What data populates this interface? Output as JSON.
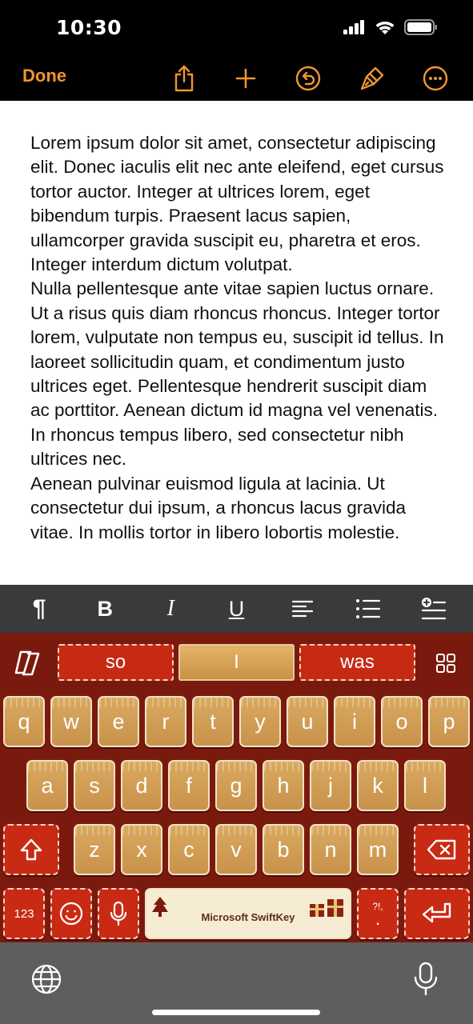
{
  "status": {
    "time": "10:30"
  },
  "nav": {
    "done_label": "Done",
    "icons": [
      "share-icon",
      "plus-icon",
      "undo-icon",
      "paintbrush-icon",
      "more-icon"
    ],
    "accent": "#f0962e"
  },
  "document": {
    "paragraphs": [
      "Lorem ipsum dolor sit amet, consectetur adipiscing elit. Donec iaculis elit nec ante eleifend, eget cursus tortor auctor. Integer at ultrices lorem, eget bibendum turpis. Praesent lacus sapien, ullamcorper gravida suscipit eu, pharetra et eros. Integer interdum dictum volutpat.",
      "Nulla pellentesque ante vitae sapien luctus ornare. Ut a risus quis diam rhoncus rhoncus. Integer tortor lorem, vulputate non tempus eu, suscipit id tellus. In laoreet sollicitudin quam, et condimentum justo ultrices eget. Pellentesque hendrerit suscipit diam ac porttitor. Aenean dictum id magna vel venenatis. In rhoncus tempus libero, sed consectetur nibh ultrices nec.",
      "Aenean pulvinar euismod ligula at lacinia. Ut consectetur dui ipsum, a rhoncus lacus gravida vitae. In mollis tortor in libero lobortis molestie."
    ]
  },
  "format_toolbar": {
    "paragraph": "¶",
    "bold": "B",
    "italic": "I",
    "underline": "U"
  },
  "keyboard": {
    "suggestions": [
      "so",
      "I",
      "was"
    ],
    "row1": [
      "q",
      "w",
      "e",
      "r",
      "t",
      "y",
      "u",
      "i",
      "o",
      "p"
    ],
    "row2": [
      "a",
      "s",
      "d",
      "f",
      "g",
      "h",
      "j",
      "k",
      "l"
    ],
    "row3": [
      "z",
      "x",
      "c",
      "v",
      "b",
      "n",
      "m"
    ],
    "numbers_label": "123",
    "space_label": "Microsoft SwiftKey",
    "punct_label": "?!,",
    "punct_dot": "."
  }
}
